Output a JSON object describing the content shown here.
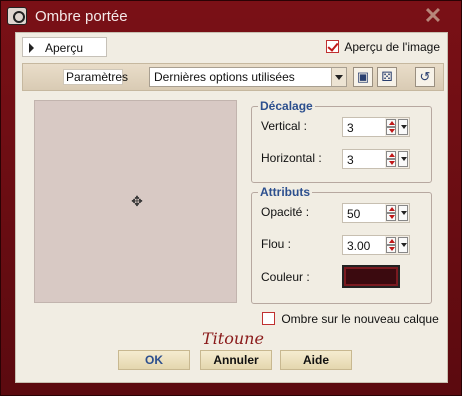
{
  "window": {
    "title": "Ombre portée"
  },
  "toolbar": {
    "apercu_label": "Aperçu",
    "apercu_image_label": "Aperçu de l'image",
    "apercu_image_checked": true
  },
  "params": {
    "label": "Paramètres",
    "preset": "Dernières options utilisées"
  },
  "decalage": {
    "title": "Décalage",
    "vertical_label": "Vertical :",
    "vertical_value": "3",
    "horizontal_label": "Horizontal :",
    "horizontal_value": "3"
  },
  "attributs": {
    "title": "Attributs",
    "opacite_label": "Opacité :",
    "opacite_value": "50",
    "flou_label": "Flou :",
    "flou_value": "3.00",
    "couleur_label": "Couleur :",
    "couleur_value": "#3b0a0f"
  },
  "ombre_calque": {
    "label": "Ombre sur le nouveau calque",
    "checked": false
  },
  "signature": "Titoune",
  "buttons": {
    "ok": "OK",
    "annuler": "Annuler",
    "aide": "Aide"
  },
  "colors": {
    "window_bg": "#5b0a0f",
    "panel_bg": "#f1ede3",
    "group_title": "#2c4f8e",
    "preview_bg": "#d8c9c4"
  }
}
